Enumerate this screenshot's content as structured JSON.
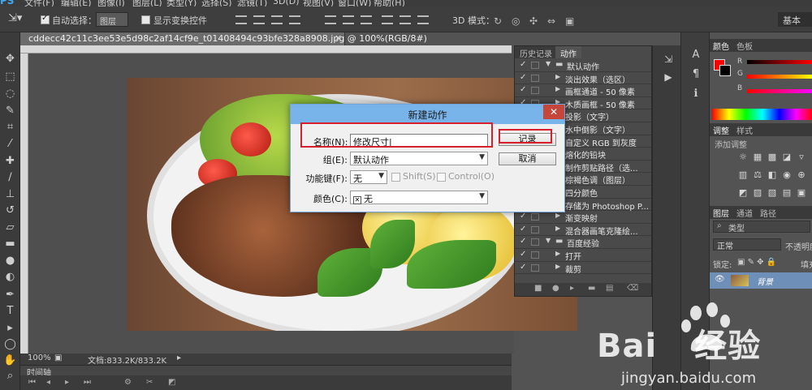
{
  "app": {
    "logo": "PS",
    "menu": [
      "文件(F)",
      "编辑(E)",
      "图像(I)",
      "图层(L)",
      "类型(Y)",
      "选择(S)",
      "滤镜(T)",
      "3D(D)",
      "视图(V)",
      "窗口(W)",
      "帮助(H)"
    ]
  },
  "options_bar": {
    "auto_select_label": "自动选择：",
    "auto_select_value": "图层",
    "transform_label": "显示变换控件",
    "mode3d_label": "3D 模式：",
    "workspace": "基本"
  },
  "document": {
    "tab_title": "cddecc42c11c3ee53e5d98c2af14cf9e_t01408494c93bfe328a8908.jpg @ 100%(RGB/8#)",
    "close": "×",
    "zoom": "100%",
    "doc_info": "文档:833.2K/833.2K",
    "timeline_label": "时间轴"
  },
  "actions_panel": {
    "tabs": [
      "历史记录",
      "动作"
    ],
    "active_tab": "动作",
    "rows": [
      {
        "indent": 0,
        "expanded": true,
        "label": "默认动作",
        "folder": true
      },
      {
        "indent": 1,
        "expanded": false,
        "label": "淡出效果（选区）"
      },
      {
        "indent": 1,
        "expanded": false,
        "label": "画框通道 - 50 像素"
      },
      {
        "indent": 1,
        "expanded": false,
        "label": "木质画框 - 50 像素"
      },
      {
        "indent": 1,
        "expanded": false,
        "label": "投影（文字）"
      },
      {
        "indent": 1,
        "expanded": false,
        "label": "水中倒影（文字）"
      },
      {
        "indent": 1,
        "expanded": false,
        "label": "自定义 RGB 到灰度"
      },
      {
        "indent": 1,
        "expanded": false,
        "label": "熔化的铅块"
      },
      {
        "indent": 1,
        "expanded": false,
        "label": "制作剪贴路径（选..."
      },
      {
        "indent": 1,
        "expanded": false,
        "label": "棕褐色调（图层）"
      },
      {
        "indent": 1,
        "expanded": false,
        "label": "四分颜色"
      },
      {
        "indent": 1,
        "expanded": false,
        "label": "存储为 Photoshop P..."
      },
      {
        "indent": 1,
        "expanded": false,
        "label": "渐变映射"
      },
      {
        "indent": 1,
        "expanded": false,
        "label": "混合器画笔克隆绘..."
      },
      {
        "indent": 0,
        "expanded": true,
        "label": "百度经验",
        "folder": true
      },
      {
        "indent": 1,
        "expanded": false,
        "label": "打开"
      },
      {
        "indent": 1,
        "expanded": false,
        "label": "裁剪"
      }
    ]
  },
  "right_panels": {
    "color_tabs": [
      "颜色",
      "色板"
    ],
    "color_sliders": [
      "R",
      "G",
      "B"
    ],
    "adjust_tabs": [
      "调整",
      "样式"
    ],
    "adjust_hint": "添加调整",
    "layers_tabs": [
      "图层",
      "通道",
      "路径"
    ],
    "kind_label": "类型",
    "blend_mode": "正常",
    "opacity_label": "不透明度",
    "lock_label": "锁定:",
    "fill_label": "填充",
    "layer_name": "背景"
  },
  "dialog": {
    "title": "新建动作",
    "close": "✕",
    "name_label": "名称(N):",
    "name_value": "修改尺寸",
    "set_label": "组(E):",
    "set_value": "默认动作",
    "fkey_label": "功能键(F):",
    "fkey_value": "无",
    "shift_label": "Shift(S)",
    "control_label": "Control(O)",
    "color_label": "颜色(C):",
    "color_value": "无",
    "record_button": "记录",
    "cancel_button": "取消"
  },
  "watermark": {
    "brand": "Bai",
    "brand_suffix": "经验",
    "domain": "jingyan.baidu.com"
  },
  "colors": {
    "accent_blue": "#53a0e8",
    "highlight_red": "#d6202e",
    "foreground": "#ff0000",
    "background": "#000000"
  }
}
